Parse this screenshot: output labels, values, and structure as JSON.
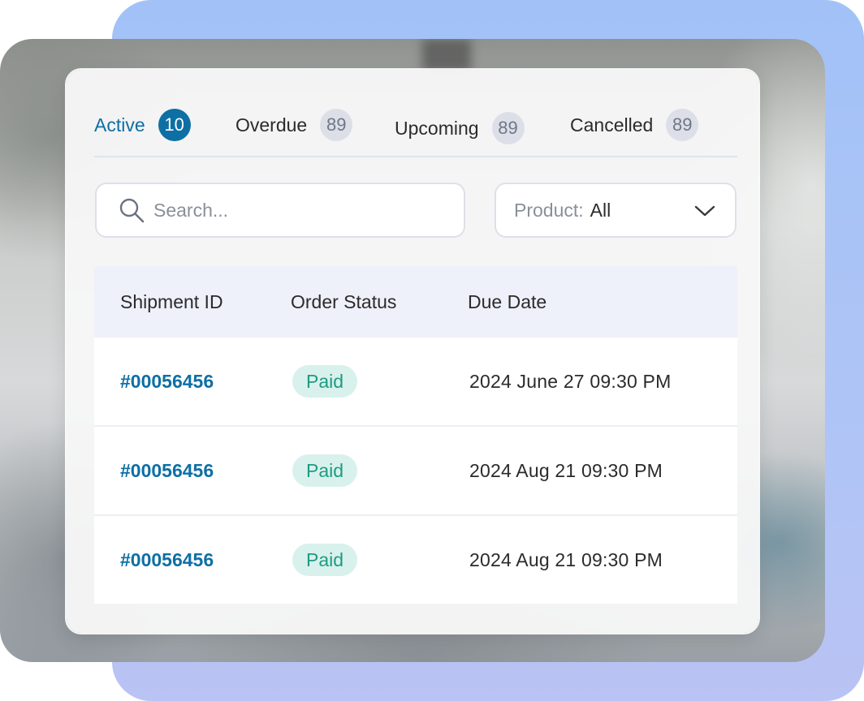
{
  "tabs": [
    {
      "label": "Active",
      "count": "10",
      "active": true
    },
    {
      "label": "Overdue",
      "count": "89",
      "active": false
    },
    {
      "label": "Upcoming",
      "count": "89",
      "active": false
    },
    {
      "label": "Cancelled",
      "count": "89",
      "active": false
    }
  ],
  "search": {
    "placeholder": "Search...",
    "icon": "search-icon"
  },
  "filter": {
    "prefix": "Product:",
    "value": "All",
    "icon": "chevron-down-icon"
  },
  "table": {
    "columns": [
      "Shipment ID",
      "Order Status",
      "Due Date"
    ],
    "rows": [
      {
        "id": "#00056456",
        "status": "Paid",
        "due": "2024 June 27 09:30 PM"
      },
      {
        "id": "#00056456",
        "status": "Paid",
        "due": "2024 Aug 21 09:30 PM"
      },
      {
        "id": "#00056456",
        "status": "Paid",
        "due": "2024 Aug 21 09:30 PM"
      }
    ]
  },
  "colors": {
    "accent": "#0e6fa4",
    "status_paid_bg": "#d8f1ec",
    "status_paid_text": "#1e9b83",
    "backdrop": "#a9c3f6"
  }
}
